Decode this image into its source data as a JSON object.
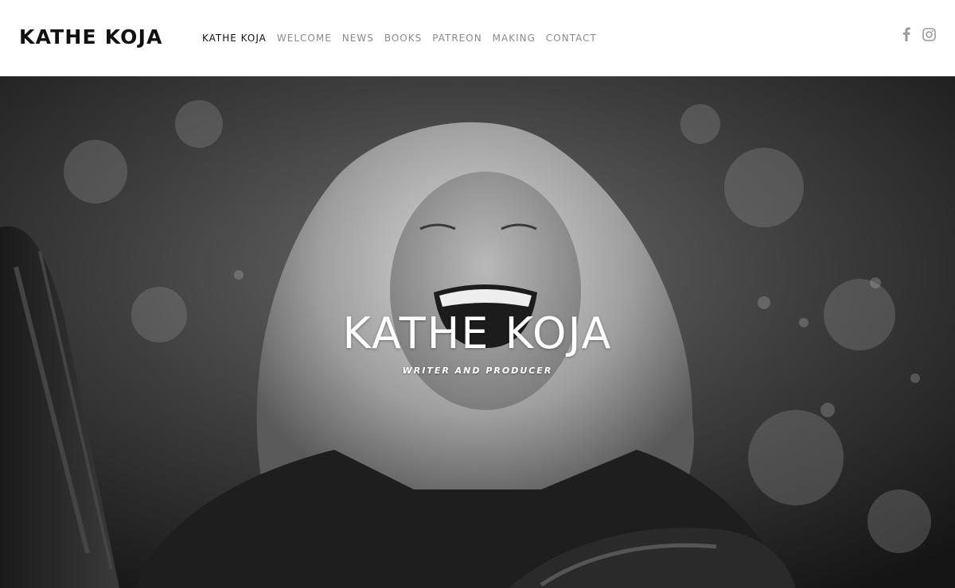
{
  "site": {
    "brand": "KATHE KOJA"
  },
  "nav": {
    "items": [
      {
        "label": "KATHE KOJA",
        "active": true
      },
      {
        "label": "WELCOME",
        "active": false
      },
      {
        "label": "NEWS",
        "active": false
      },
      {
        "label": "BOOKS",
        "active": false
      },
      {
        "label": "PATREON",
        "active": false
      },
      {
        "label": "MAKING",
        "active": false
      },
      {
        "label": "CONTACT",
        "active": false
      }
    ]
  },
  "social": {
    "icons": [
      "facebook-icon",
      "instagram-icon"
    ],
    "color": "#9a9a9a"
  },
  "hero": {
    "title": "KATHE KOJA",
    "subtitle": "WRITER AND PRODUCER",
    "image": "black-and-white-portrait-photo"
  },
  "colors": {
    "nav_active": "#111111",
    "nav_inactive": "#8a8a8a",
    "hero_text": "#ffffff"
  }
}
